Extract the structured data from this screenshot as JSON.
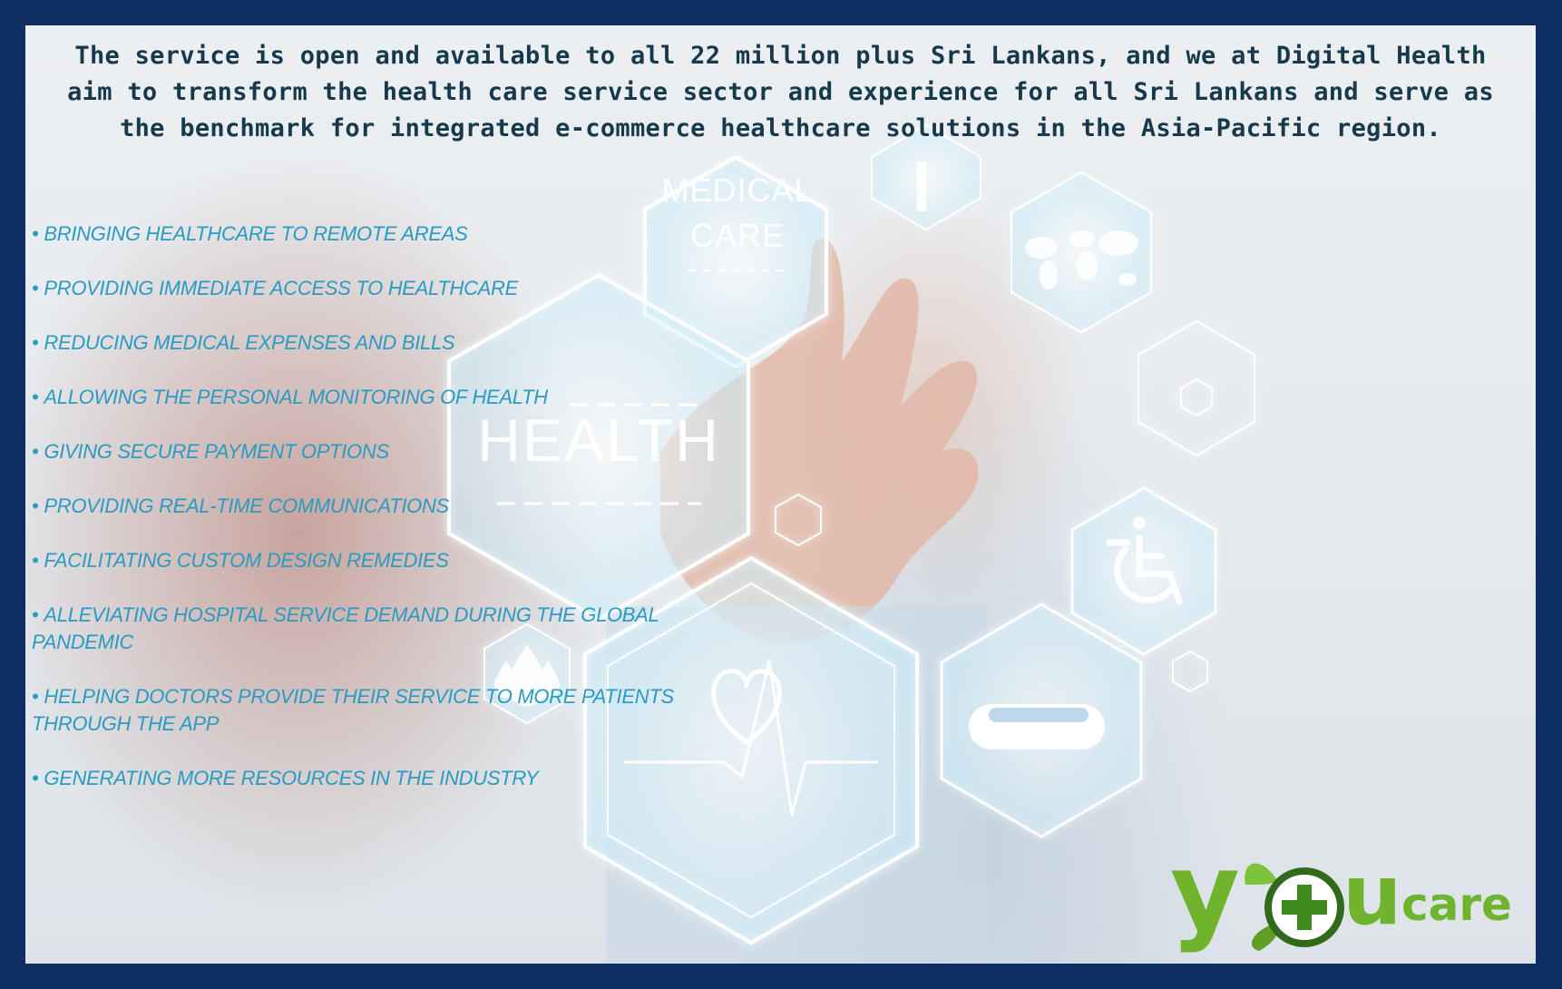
{
  "intro_text": "The service is open and available to all 22 million plus Sri Lankans, and we at Digital Health aim to transform the health care service sector and experience for all Sri Lankans and serve as the benchmark for integrated e-commerce healthcare solutions in the Asia-Pacific region.",
  "benefits": [
    "BRINGING HEALTHCARE TO REMOTE AREAS",
    "PROVIDING IMMEDIATE ACCESS TO HEALTHCARE",
    "REDUCING MEDICAL EXPENSES AND BILLS",
    "ALLOWING THE PERSONAL MONITORING OF HEALTH",
    "GIVING SECURE PAYMENT OPTIONS",
    "PROVIDING REAL-TIME COMMUNICATIONS",
    "FACILITATING CUSTOM DESIGN REMEDIES",
    "ALLEVIATING HOSPITAL SERVICE DEMAND DURING THE GLOBAL PANDEMIC",
    "HELPING DOCTORS PROVIDE THEIR SERVICE TO MORE PATIENTS THROUGH THE APP",
    "GENERATING MORE RESOURCES IN THE INDUSTRY"
  ],
  "bullet": "•",
  "hex_labels": {
    "medical_line1": "MEDICAL",
    "medical_line2": "CARE",
    "health": "HEALTH"
  },
  "icons": [
    "world-map-icon",
    "wheelchair-icon",
    "pill-capsule-icon",
    "heartbeat-icon",
    "water-drops-icon",
    "cross-icon"
  ],
  "logo": {
    "y": "y",
    "u": "u",
    "care": "care"
  },
  "colors": {
    "border": "#0f2e64",
    "intro_text": "#163a4c",
    "benefit_text": "#2a9bc2",
    "logo_green": "#6fb42c"
  }
}
